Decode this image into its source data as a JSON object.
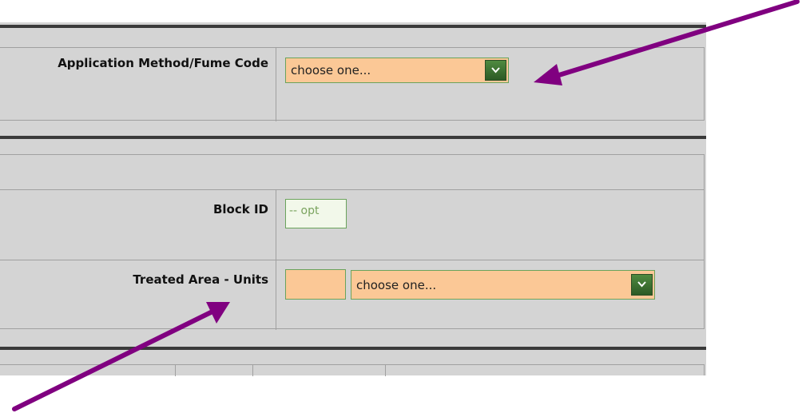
{
  "fields": {
    "application_method": {
      "label": "Application Method/Fume Code",
      "value": "choose one..."
    },
    "block_id": {
      "label": "Block ID",
      "placeholder": "-- opt"
    },
    "treated_area_units": {
      "label": "Treated Area - Units",
      "area_value": "",
      "units_value": "choose one..."
    }
  },
  "icons": {
    "dropdown": "chevron-down-icon"
  },
  "colors": {
    "required_field": "#fbc896",
    "optional_field": "#f2f8ea",
    "dropdown_button": "#3a6e30",
    "annotation_arrow": "#800080",
    "panel": "#d4d4d4"
  }
}
